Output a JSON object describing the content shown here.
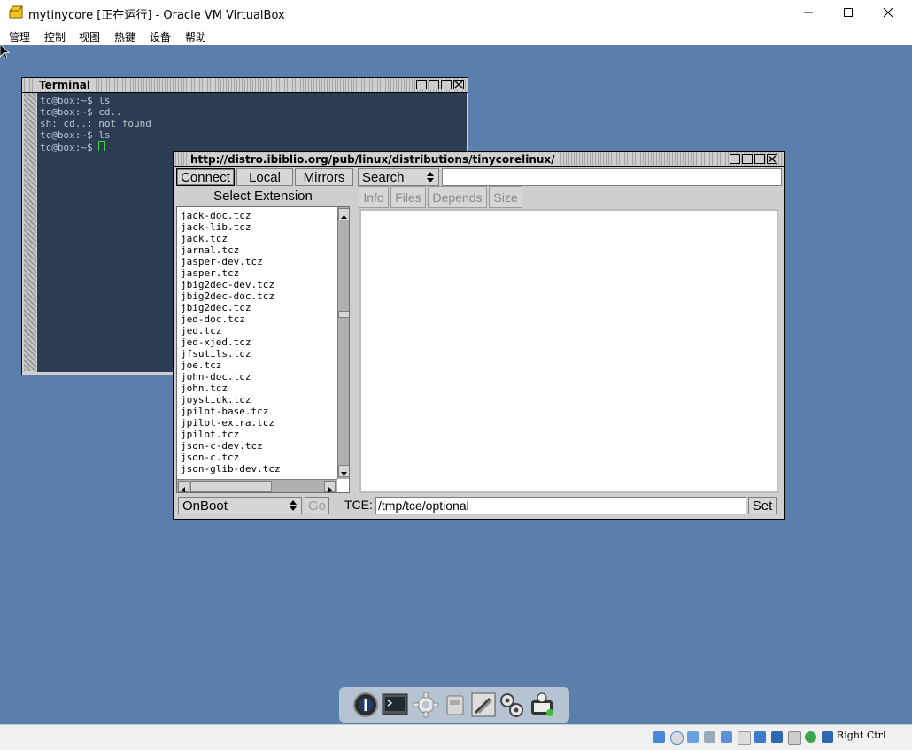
{
  "host_window": {
    "title": "mytinycore [正在运行] - Oracle VM VirtualBox",
    "menu": [
      "管理",
      "控制",
      "视图",
      "热键",
      "设备",
      "帮助"
    ],
    "host_key": "Right Ctrl"
  },
  "terminal": {
    "title": "Terminal",
    "lines": [
      "tc@box:~$ ls",
      "tc@box:~$ cd..",
      "sh: cd..: not found",
      "tc@box:~$ ls",
      "tc@box:~$ "
    ]
  },
  "apps": {
    "title": "http://distro.ibiblio.org/pub/linux/distributions/tinycorelinux/",
    "buttons": {
      "connect": "Connect",
      "local": "Local",
      "mirrors": "Mirrors",
      "go": "Go",
      "set": "Set"
    },
    "search_mode": "Search",
    "search_value": "",
    "list_heading": "Select Extension",
    "tabs": [
      "Info",
      "Files",
      "Depends",
      "Size"
    ],
    "extensions": [
      "jack-doc.tcz",
      "jack-lib.tcz",
      "jack.tcz",
      "jarnal.tcz",
      "jasper-dev.tcz",
      "jasper.tcz",
      "jbig2dec-dev.tcz",
      "jbig2dec-doc.tcz",
      "jbig2dec.tcz",
      "jed-doc.tcz",
      "jed.tcz",
      "jed-xjed.tcz",
      "jfsutils.tcz",
      "joe.tcz",
      "john-doc.tcz",
      "john.tcz",
      "joystick.tcz",
      "jpilot-base.tcz",
      "jpilot-extra.tcz",
      "jpilot.tcz",
      "json-c-dev.tcz",
      "json-c.tcz",
      "json-glib-dev.tcz"
    ],
    "install_mode": "OnBoot",
    "tce_label": "TCE:",
    "tce_path": "/tmp/tce/optional"
  },
  "dock": {
    "icons": [
      "power-icon",
      "terminal-icon",
      "settings-gear-icon",
      "mount-drive-icon",
      "control-panel-icon",
      "services-gears-icon",
      "apps-installer-icon"
    ]
  },
  "colors": {
    "desktop": "#5b7fad",
    "terminal_bg": "#2c3c54",
    "terminal_text": "#b9c5d2",
    "window_gray": "#cfcfcf"
  }
}
